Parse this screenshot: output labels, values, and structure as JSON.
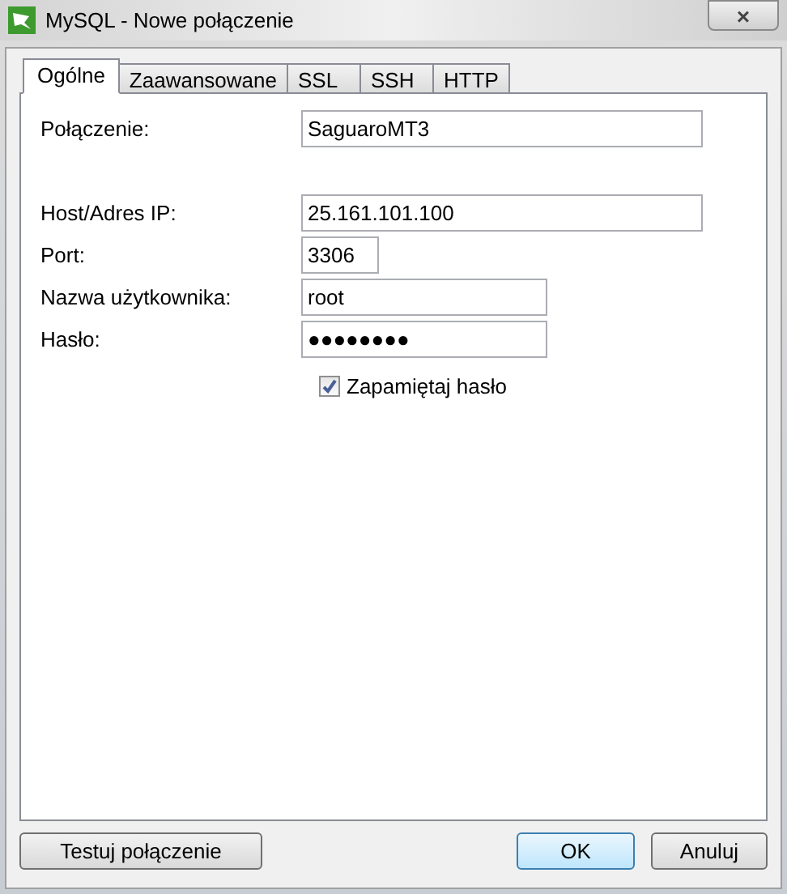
{
  "window": {
    "title": "MySQL - Nowe połączenie",
    "close": "×"
  },
  "tabs": [
    {
      "label": "Ogólne",
      "selected": true
    },
    {
      "label": "Zaawansowane",
      "selected": false
    },
    {
      "label": "SSL",
      "selected": false
    },
    {
      "label": "SSH",
      "selected": false
    },
    {
      "label": "HTTP",
      "selected": false
    }
  ],
  "connection": {
    "label": "Połączenie:",
    "value": "SaguaroMT3"
  },
  "host": {
    "label": "Host/Adres IP:",
    "value": "25.161.101.100"
  },
  "port": {
    "label": "Port:",
    "value": "3306"
  },
  "username": {
    "label": "Nazwa użytkownika:",
    "value": "root"
  },
  "password": {
    "label": "Hasło:",
    "value": "●●●●●●●●"
  },
  "remember_password": {
    "label": "Zapamiętaj hasło",
    "checked": true
  },
  "buttons": [
    {
      "label": "Testuj połączenie",
      "default": false
    },
    {
      "label": "OK",
      "default": true
    },
    {
      "label": "Anuluj",
      "default": false
    }
  ]
}
